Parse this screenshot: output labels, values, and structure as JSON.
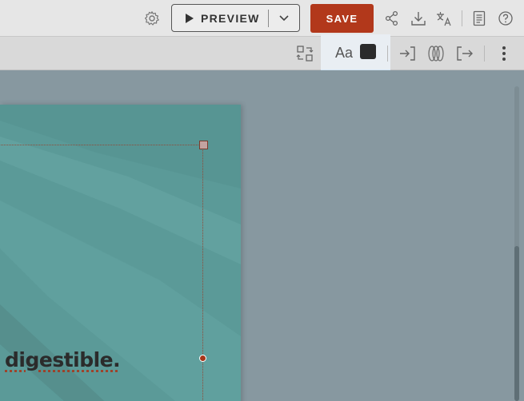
{
  "topbar": {
    "preview_label": "PREVIEW",
    "save_label": "SAVE",
    "icons": [
      "gear-icon",
      "play-icon",
      "chevron-down-icon",
      "share-icon",
      "download-icon",
      "translate-icon",
      "notes-icon",
      "help-icon"
    ]
  },
  "toolbar2": {
    "text_style_label": "Aa",
    "text_color": "#2b2b2b",
    "icons": [
      "swap-layout-icon",
      "enter-animation-icon",
      "emphasis-animation-icon",
      "exit-animation-icon",
      "more-options-icon"
    ]
  },
  "slide": {
    "visible_text": "digestible.",
    "background": "#5b9a98",
    "accent": "#a7361a"
  }
}
